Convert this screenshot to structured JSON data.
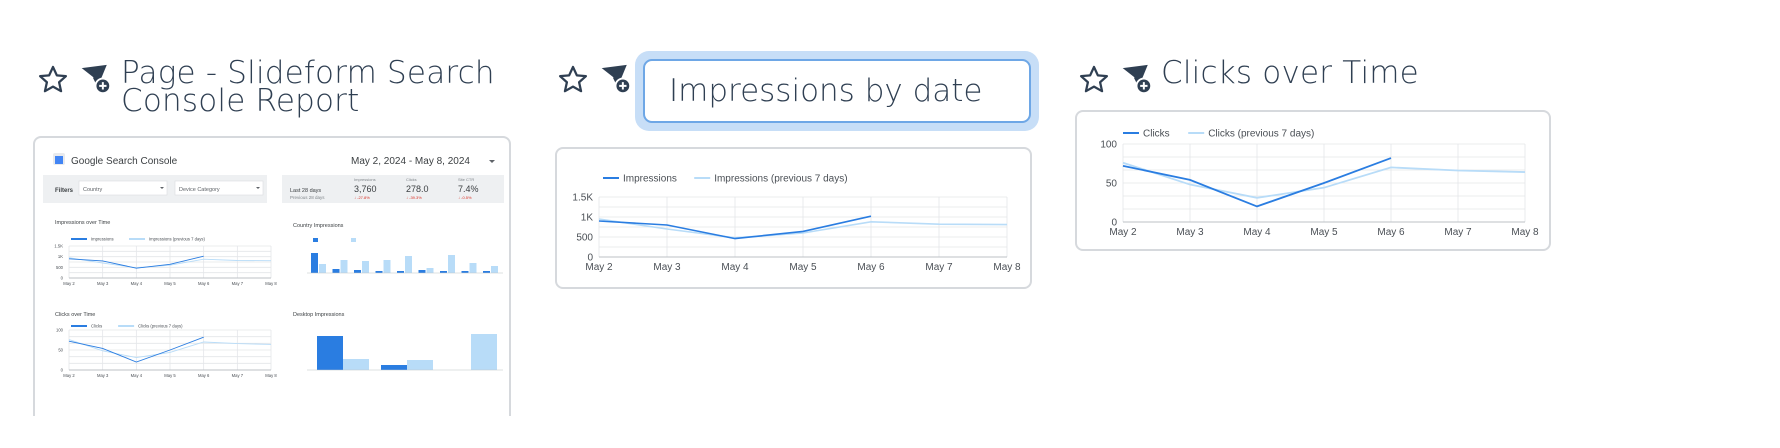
{
  "cards": [
    {
      "title_line1": "Page - Slideform Search",
      "title_line2": "Console Report"
    },
    {
      "title_input_value": "Impressions by date"
    },
    {
      "title": "Clicks over Time"
    }
  ],
  "report": {
    "header_title": "Google Search Console",
    "date_range": "May 2, 2024 - May 8, 2024",
    "filters_label": "Filters",
    "filter_country": "Country",
    "filter_device": "Device Category",
    "kpi": {
      "period": "Last 28 days",
      "period_sub": "Previous 28 days",
      "items": [
        {
          "label": "Impressions",
          "value": "3,760",
          "delta": "-27.8%"
        },
        {
          "label": "Clicks",
          "value": "278.0",
          "delta": "-39.3%"
        },
        {
          "label": "Site CTR",
          "value": "7.4%",
          "delta": "-0.5%"
        }
      ]
    },
    "impressions_title": "Impressions over Time",
    "country_title": "Country Impressions",
    "clicks_title": "Clicks over Time",
    "desktop_title": "Desktop Impressions"
  },
  "colors": {
    "current": "#2a7de1",
    "previous": "#b8dcf8",
    "grid": "#e4e6e9",
    "axis_text": "#4a4f55"
  },
  "chart_data": [
    {
      "type": "line",
      "title": "",
      "x": [
        "May 2",
        "May 3",
        "May 4",
        "May 5",
        "May 6",
        "May 7",
        "May 8"
      ],
      "yticks": [
        "0",
        "500",
        "1K",
        "1.5K"
      ],
      "ylim": [
        0,
        1500
      ],
      "grid": true,
      "legend": "top-left",
      "series": [
        {
          "name": "Impressions",
          "values": [
            900,
            800,
            460,
            640,
            1020,
            null,
            null
          ]
        },
        {
          "name": "Impressions (previous 7 days)",
          "values": [
            950,
            700,
            480,
            600,
            880,
            820,
            810
          ]
        }
      ]
    },
    {
      "type": "line",
      "title": "",
      "x": [
        "May 2",
        "May 3",
        "May 4",
        "May 5",
        "May 6",
        "May 7",
        "May 8"
      ],
      "yticks": [
        "0",
        "50",
        "100"
      ],
      "ylim": [
        0,
        100
      ],
      "grid": true,
      "legend": "top-left",
      "series": [
        {
          "name": "Clicks",
          "values": [
            72,
            54,
            20,
            50,
            82,
            null,
            null
          ]
        },
        {
          "name": "Clicks (previous 7 days)",
          "values": [
            76,
            48,
            31,
            44,
            70,
            66,
            64
          ]
        }
      ]
    }
  ]
}
